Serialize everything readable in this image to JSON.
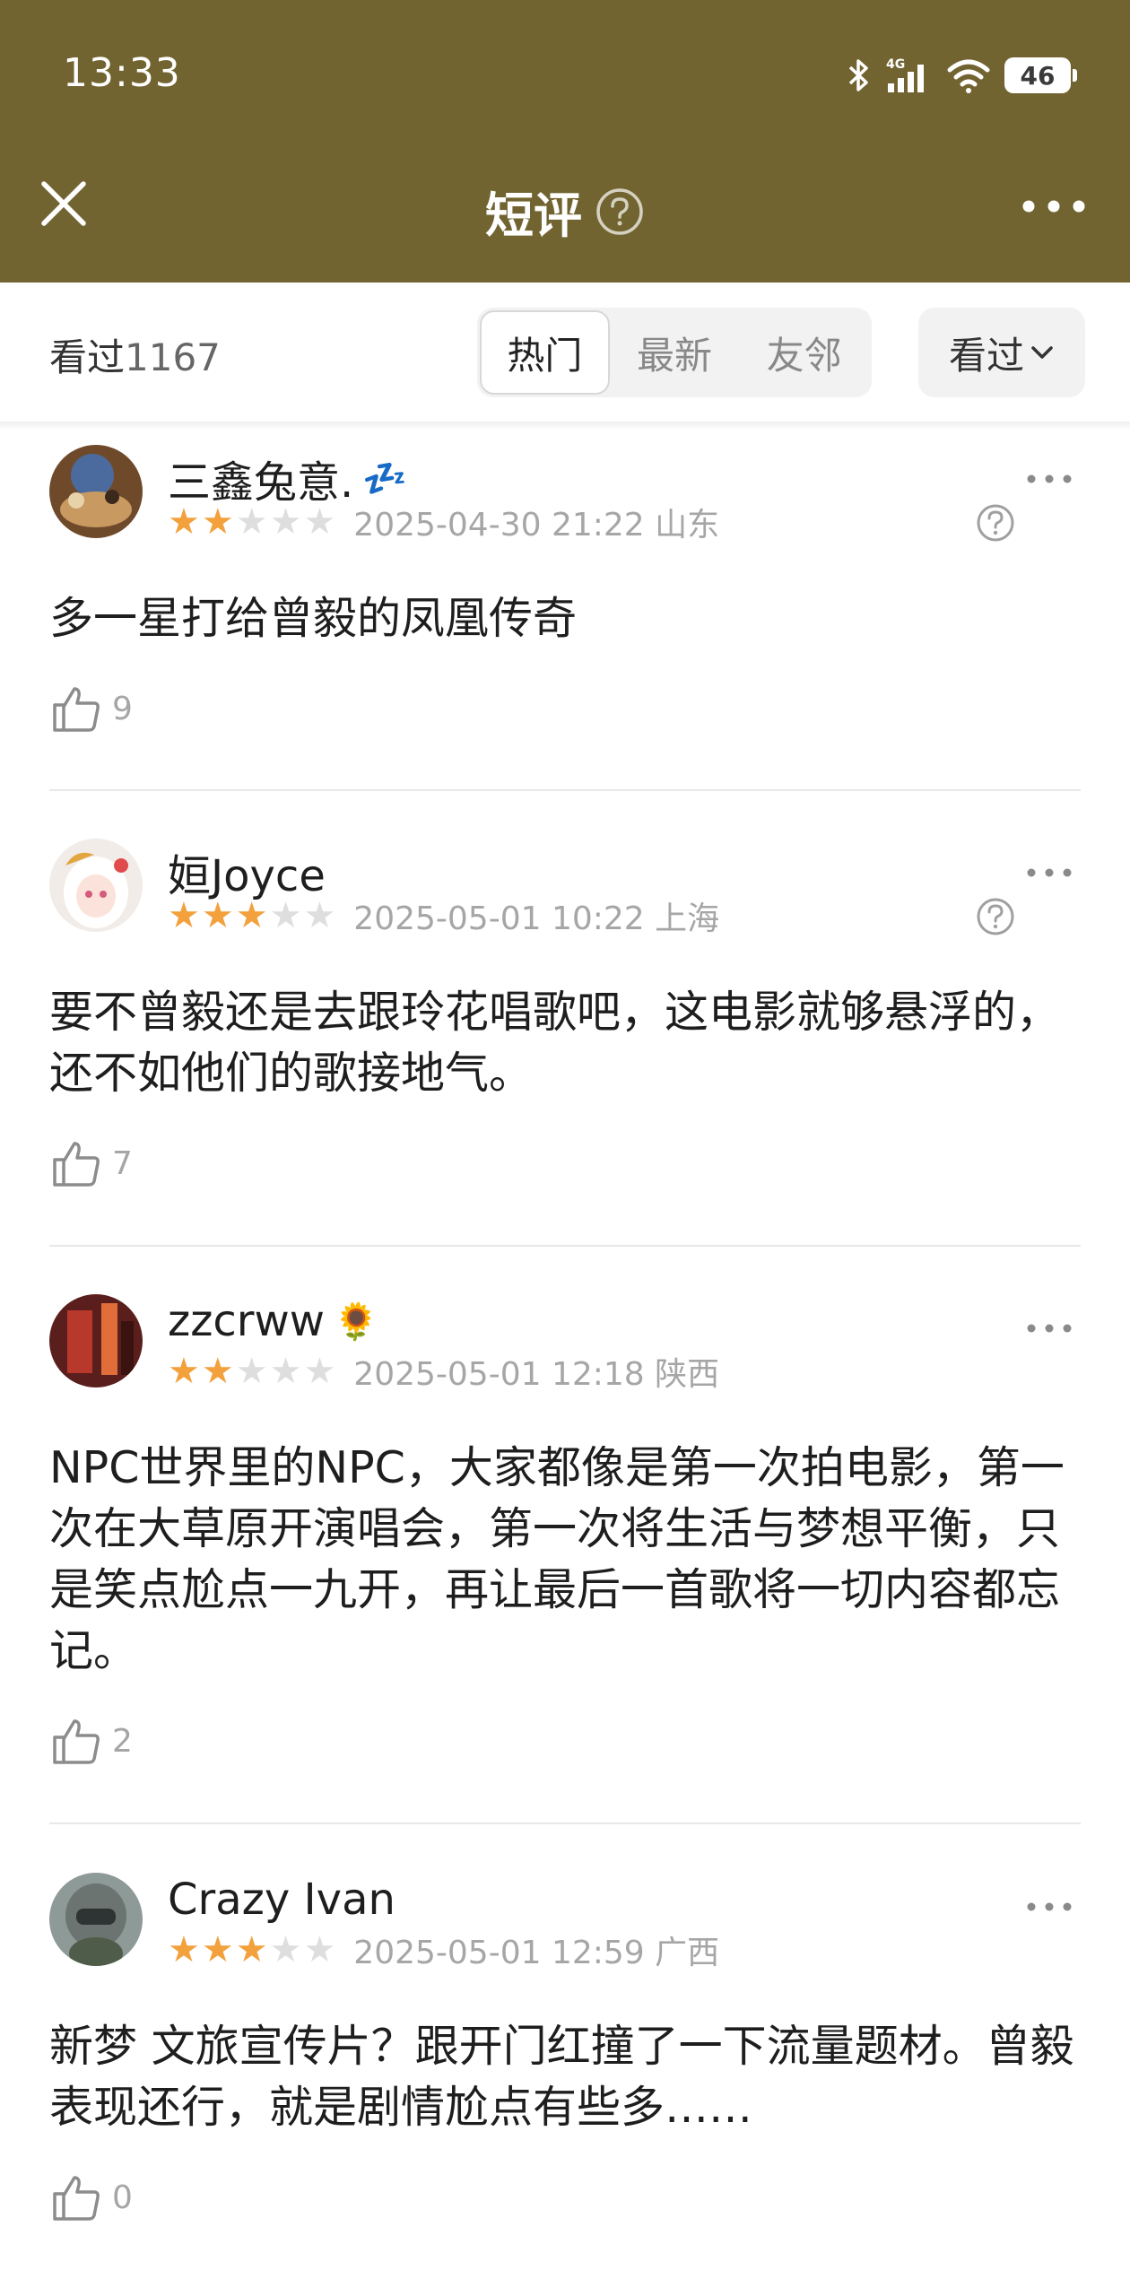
{
  "status_bar": {
    "time": "13:33",
    "network": "4G",
    "battery": "46"
  },
  "nav": {
    "title": "短评"
  },
  "filter": {
    "seen_label": "看过",
    "seen_count": "1167",
    "tabs": [
      "热门",
      "最新",
      "友邻"
    ],
    "active_tab": "热门",
    "dropdown_label": "看过"
  },
  "colors": {
    "header": "#726430",
    "star_on": "#f2a13c",
    "star_off": "#dedede"
  },
  "comments": [
    {
      "user": "三鑫兔意.",
      "badge": "💤",
      "stars": 2,
      "date": "2025-04-30 21:22",
      "location": "山东",
      "text": "多一星打给曾毅的凤凰传奇",
      "likes": "9",
      "has_help": true
    },
    {
      "user": "姮Joyce",
      "badge": "",
      "stars": 3,
      "date": "2025-05-01 10:22",
      "location": "上海",
      "text": "要不曾毅还是去跟玲花唱歌吧，这电影就够悬浮的，还不如他们的歌接地气。",
      "likes": "7",
      "has_help": true
    },
    {
      "user": "zzcrww",
      "badge": "🌻",
      "stars": 2,
      "date": "2025-05-01 12:18",
      "location": "陕西",
      "text": "NPC世界里的NPC，大家都像是第一次拍电影，第一次在大草原开演唱会，第一次将生活与梦想平衡，只是笑点尬点一九开，再让最后一首歌将一切内容都忘记。",
      "likes": "2",
      "has_help": false
    },
    {
      "user": "Crazy Ivan",
      "badge": "",
      "stars": 3,
      "date": "2025-05-01 12:59",
      "location": "广西",
      "text": "新梦  文旅宣传片？跟开门红撞了一下流量题材。曾毅表现还行，就是剧情尬点有些多……",
      "likes": "0",
      "has_help": false
    }
  ]
}
